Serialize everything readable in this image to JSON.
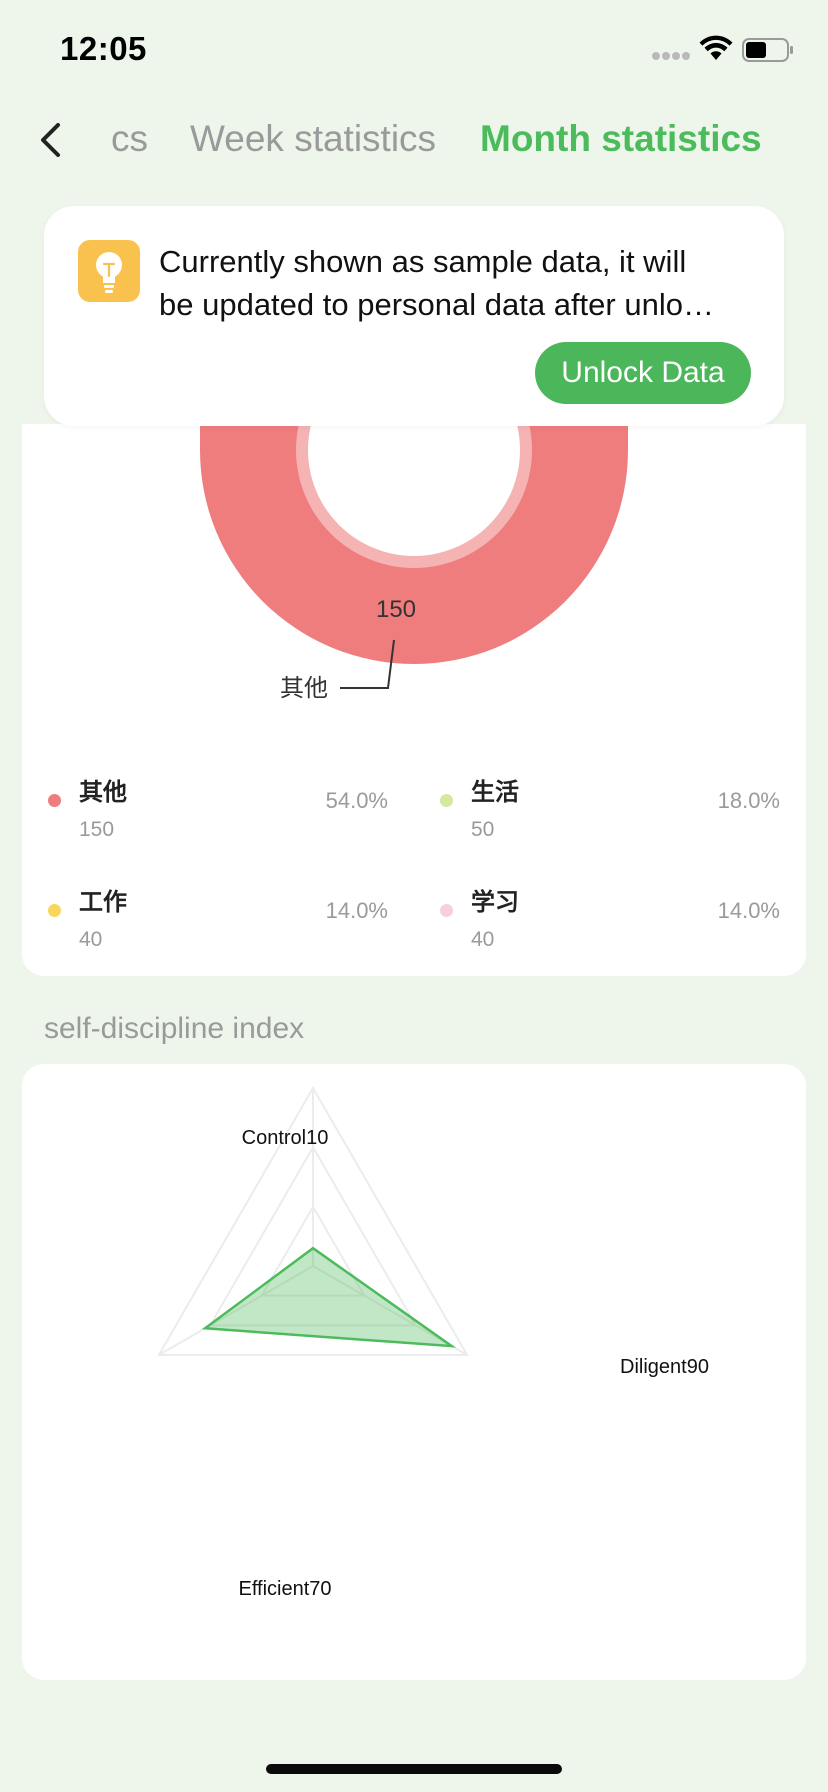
{
  "status_bar": {
    "time": "12:05"
  },
  "nav": {
    "tabs": [
      {
        "label": "cs",
        "active": false
      },
      {
        "label": "Week statistics",
        "active": false
      },
      {
        "label": "Month statistics",
        "active": true
      }
    ]
  },
  "notice": {
    "line1": "Currently shown as sample data, it will",
    "line2": "be updated to personal data after unlo…",
    "unlock_label": "Unlock Data"
  },
  "colors": {
    "accent": "#4cbb5c",
    "other": "#ef7d7d",
    "life": "#d4e8a0",
    "work": "#f8d55c",
    "study": "#f8d0dc"
  },
  "chart_data": [
    {
      "type": "pie",
      "slices": [
        {
          "name": "其他",
          "value": 150,
          "percent": "54.0%",
          "color": "#ef7d7d"
        },
        {
          "name": "生活",
          "value": 50,
          "percent": "18.0%",
          "color": "#d4e8a0"
        },
        {
          "name": "工作",
          "value": 40,
          "percent": "14.0%",
          "color": "#f8d55c"
        },
        {
          "name": "学习",
          "value": 40,
          "percent": "14.0%",
          "color": "#f8d0dc"
        }
      ],
      "shown_label": {
        "name": "其他",
        "value": "150"
      }
    },
    {
      "type": "radar",
      "title": "self-discipline index",
      "max": 100,
      "axes": [
        {
          "name": "Control",
          "label": "Control10",
          "value": 10
        },
        {
          "name": "Diligent",
          "label": "Diligent90",
          "value": 90
        },
        {
          "name": "Efficient",
          "label": "Efficient70",
          "value": 70
        }
      ],
      "series_color": "#4cbb5c"
    }
  ]
}
